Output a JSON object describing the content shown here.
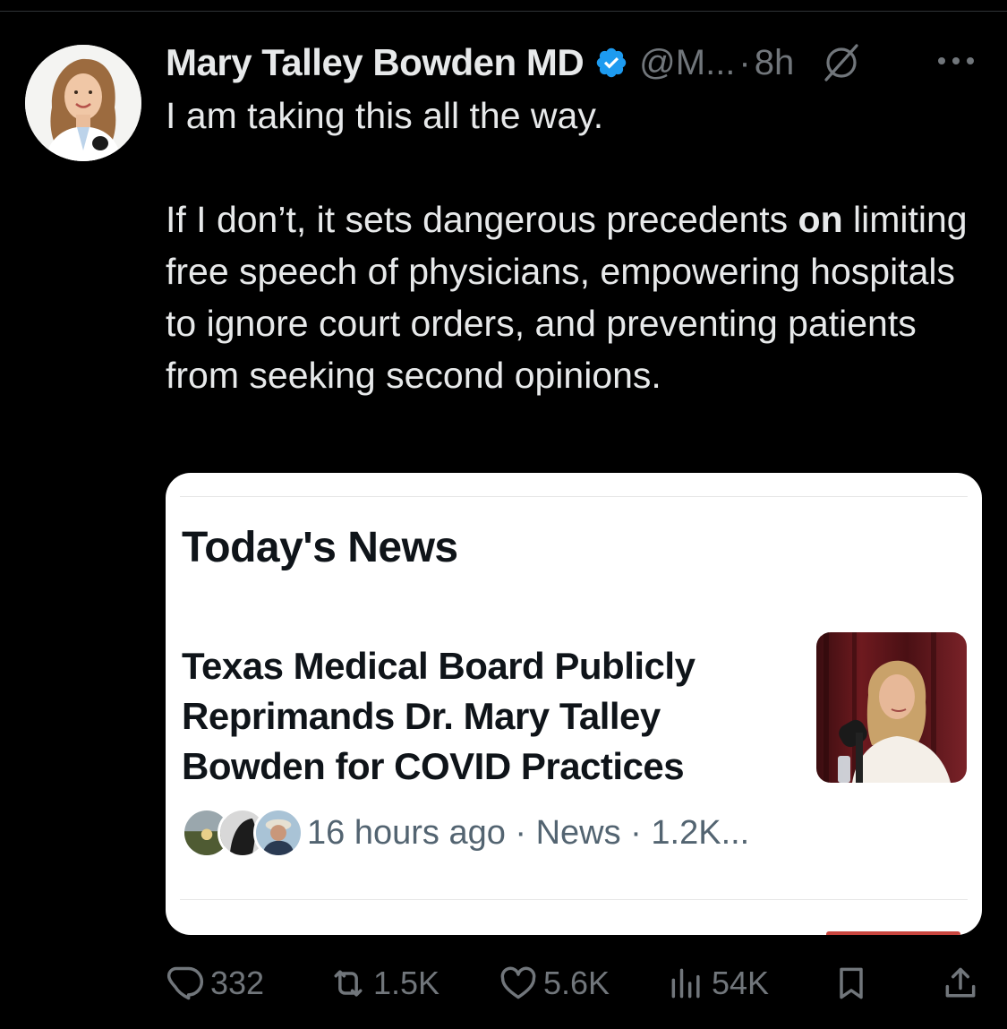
{
  "tweet": {
    "author": {
      "display_name": "Mary Talley Bowden MD",
      "handle": "@M...",
      "verified": true
    },
    "separator": "·",
    "time": "8h",
    "text": {
      "line1": "I am taking this all the way.",
      "para2_before": "If I don’t, it sets dangerous precedents ",
      "para2_bold": "on",
      "para2_after": " limiting free speech of physicians, empowering hospitals to ignore court orders, and preventing patients from seeking second opinions."
    },
    "quoted_card": {
      "title": "Today's News",
      "headline": "Texas Medical Board Publicly Reprimands Dr. Mary Talley Bowden for COVID Practices",
      "meta": "16 hours ago · News · 1.2K..."
    },
    "actions": {
      "replies": "332",
      "reposts": "1.5K",
      "likes": "5.6K",
      "views": "54K"
    }
  },
  "icons": {
    "verified": "verified-badge-icon",
    "grok": "grok-icon",
    "more": "more-icon",
    "reply": "reply-icon",
    "repost": "repost-icon",
    "like": "heart-icon",
    "views": "views-icon",
    "bookmark": "bookmark-icon",
    "share": "share-icon"
  },
  "colors": {
    "background": "#000000",
    "text_primary": "#e7e9ea",
    "text_secondary": "#71767b",
    "verified_blue": "#1d9bf0",
    "card_background": "#ffffff"
  }
}
